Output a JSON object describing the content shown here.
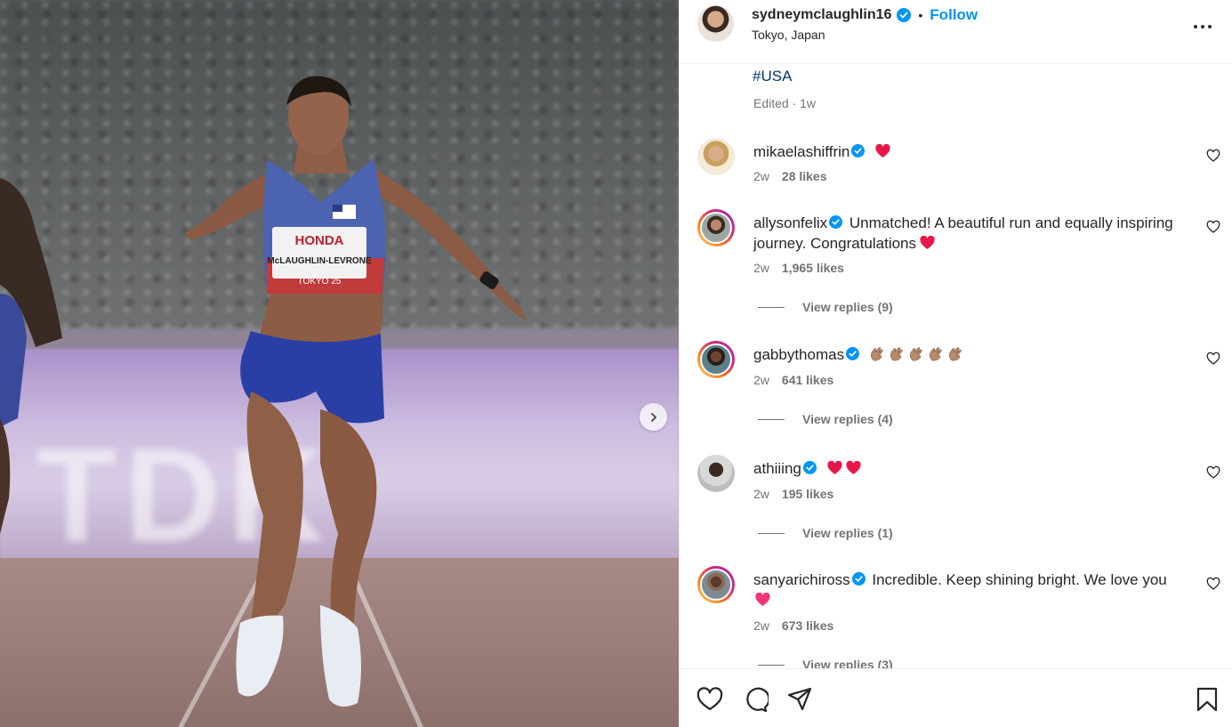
{
  "post": {
    "author": "sydneymclaughlin16",
    "verified": true,
    "follow_label": "Follow",
    "separator": "•",
    "location": "Tokyo, Japan",
    "caption_hashtag": "#USA",
    "caption_meta": "Edited · 1w",
    "bib_sponsor": "HONDA",
    "bib_name": "McLAUGHLIN-LEVRONE",
    "bib_event": "TOKYO 25"
  },
  "comments": [
    {
      "username": "mikaelashiffrin",
      "verified": true,
      "text": "",
      "emoji": [
        "red-heart"
      ],
      "age": "2w",
      "likes": "28 likes",
      "replies": ""
    },
    {
      "username": "allysonfelix",
      "verified": true,
      "text": "Unmatched! A beautiful run and equally inspiring journey. Congratulations",
      "emoji": [
        "red-heart"
      ],
      "age": "2w",
      "likes": "1,965 likes",
      "replies": "View replies (9)"
    },
    {
      "username": "gabbythomas",
      "verified": true,
      "text": "",
      "emoji": [
        "clap",
        "clap",
        "clap",
        "clap",
        "clap"
      ],
      "age": "2w",
      "likes": "641 likes",
      "replies": "View replies (4)"
    },
    {
      "username": "athiiing",
      "verified": true,
      "text": "",
      "emoji": [
        "red-heart",
        "red-heart"
      ],
      "age": "2w",
      "likes": "195 likes",
      "replies": "View replies (1)"
    },
    {
      "username": "sanyarichiross",
      "verified": true,
      "text": "Incredible. Keep shining bright. We love you",
      "emoji": [
        "pink-heart"
      ],
      "age": "2w",
      "likes": "673 likes",
      "replies": "View replies (3)"
    }
  ],
  "colors": {
    "link": "#0095f6",
    "hashtag": "#00376b",
    "verified": "#0095f6",
    "muted": "#737373",
    "text": "#262626"
  },
  "icons": {
    "header_more": "more-horizontal-icon",
    "carousel_next": "chevron-right-icon",
    "actions": [
      "heart-icon",
      "comment-icon",
      "share-icon",
      "bookmark-icon"
    ]
  }
}
